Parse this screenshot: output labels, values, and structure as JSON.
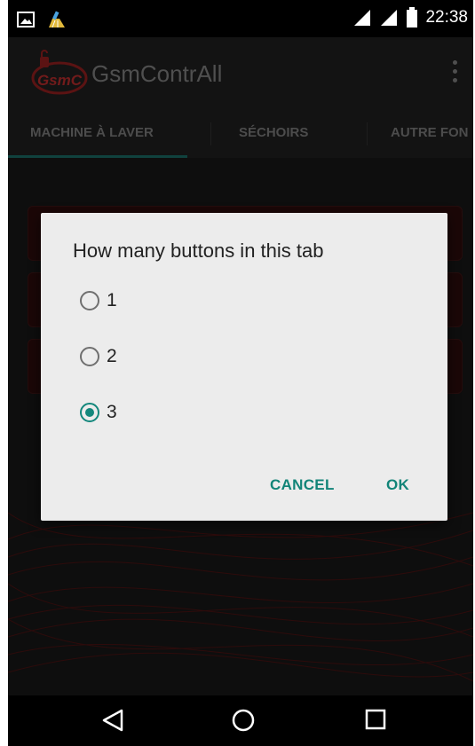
{
  "status_bar": {
    "time": "22:38",
    "left_icons": [
      "image-notification-icon",
      "cleaner-broom-icon"
    ],
    "right_icons": [
      "signal-icon",
      "signal-icon",
      "battery-icon"
    ]
  },
  "app_bar": {
    "logo_text": "GsmC",
    "title": "GsmContrAll",
    "overflow_icon": "overflow-menu-icon"
  },
  "tabs": [
    {
      "label": "MACHINE À LAVER",
      "selected": true
    },
    {
      "label": "SÉCHOIRS",
      "selected": false
    },
    {
      "label": "AUTRE FON",
      "selected": false
    }
  ],
  "dialog": {
    "title": "How many buttons in this tab",
    "options": [
      {
        "label": "1",
        "checked": false
      },
      {
        "label": "2",
        "checked": false
      },
      {
        "label": "3",
        "checked": true
      }
    ],
    "cancel_label": "CANCEL",
    "ok_label": "OK"
  },
  "colors": {
    "accent": "#13877c",
    "app_bar": "#1e1e1e",
    "dialog_bg": "#ececec",
    "logo_red": "#8c1e1e"
  },
  "nav_bar": {
    "icons": [
      "back-icon",
      "home-icon",
      "recents-icon"
    ]
  }
}
